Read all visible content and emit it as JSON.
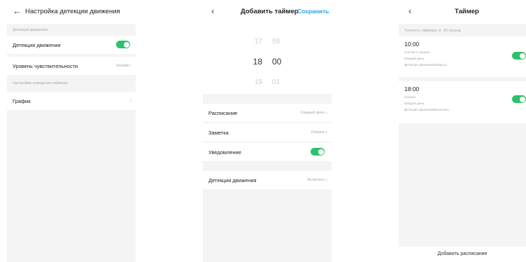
{
  "colors": {
    "accent": "#2bc26b",
    "link": "#2f9fe0"
  },
  "screen1": {
    "back_icon": "arrow-left-icon",
    "title": "Настройка детекции движения",
    "section1_label": "Детекция движения",
    "motion_label": "Детекция движения",
    "motion_enabled": true,
    "sensitivity_label": "Уровень чувствительности",
    "sensitivity_value": "Низкий",
    "section2_label": "Настройки поведения таймера",
    "schedule_label": "График"
  },
  "screen2": {
    "back_icon": "chevron-left-icon",
    "title": "Добавить таймер",
    "save_label": "Сохранить",
    "time_prev": {
      "h": "17",
      "m": "59"
    },
    "time_cur": {
      "h": "18",
      "m": "00"
    },
    "time_next": {
      "h": "19",
      "m": "01"
    },
    "repeat_label": "Расписание",
    "repeat_value": "Каждый день",
    "note_label": "Заметка",
    "note_value": "Охрана",
    "notify_label": "Уведомление",
    "notify_enabled": true,
    "motion_label": "Детекция движения",
    "motion_value": "Включить"
  },
  "screen3": {
    "back_icon": "chevron-left-icon",
    "title": "Таймер",
    "info_label": "Точность таймера +/- 30 секунд",
    "timers": [
      {
        "time": "10:00",
        "line1": "Снятие с охраны",
        "line2": "Каждый день",
        "line3": "Детекция движения/Закрыть",
        "enabled": true
      },
      {
        "time": "18:00",
        "line1": "Охрана",
        "line2": "Каждый день",
        "line3": "Детекция движения/Включить",
        "enabled": true
      }
    ],
    "add_label": "Добавить расписание"
  }
}
